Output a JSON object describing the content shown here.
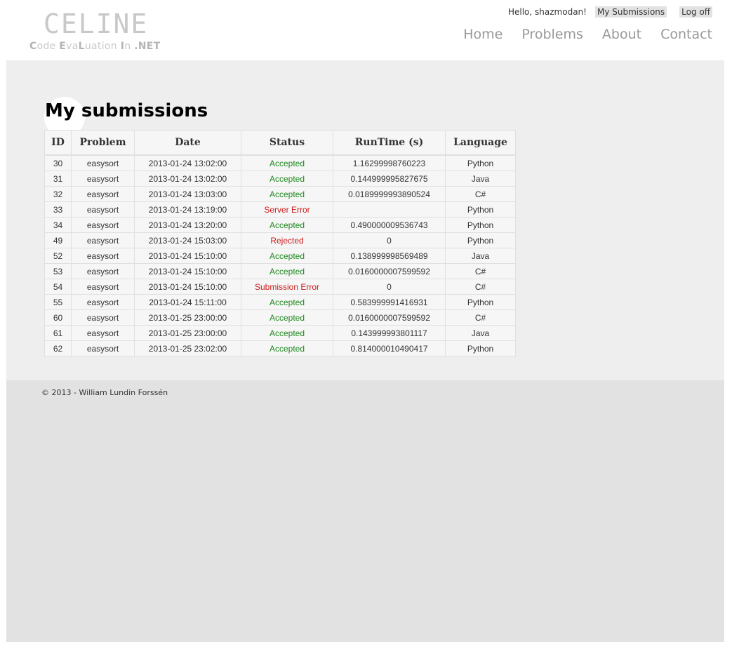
{
  "header": {
    "logo": "CELINE",
    "tagline_parts": [
      {
        "t": "C",
        "b": true
      },
      {
        "t": "ode ",
        "b": false
      },
      {
        "t": "E",
        "b": true
      },
      {
        "t": "va",
        "b": false
      },
      {
        "t": "L",
        "b": true
      },
      {
        "t": "uation ",
        "b": false
      },
      {
        "t": "I",
        "b": true
      },
      {
        "t": "n ",
        "b": false
      },
      {
        "t": ".NET",
        "b": true
      }
    ],
    "greeting": "Hello, shazmodan!",
    "my_submissions_link": "My Submissions",
    "logoff_link": "Log off",
    "nav": [
      "Home",
      "Problems",
      "About",
      "Contact"
    ]
  },
  "main": {
    "title": "My submissions",
    "table": {
      "columns": [
        "ID",
        "Problem",
        "Date",
        "Status",
        "RunTime (s)",
        "Language"
      ],
      "rows": [
        {
          "id": "30",
          "problem": "easysort",
          "date": "2013-01-24 13:02:00",
          "status": "Accepted",
          "runtime": "1.16299998760223",
          "language": "Python"
        },
        {
          "id": "31",
          "problem": "easysort",
          "date": "2013-01-24 13:02:00",
          "status": "Accepted",
          "runtime": "0.144999995827675",
          "language": "Java"
        },
        {
          "id": "32",
          "problem": "easysort",
          "date": "2013-01-24 13:03:00",
          "status": "Accepted",
          "runtime": "0.0189999993890524",
          "language": "C#"
        },
        {
          "id": "33",
          "problem": "easysort",
          "date": "2013-01-24 13:19:00",
          "status": "Server Error",
          "runtime": "",
          "language": "Python"
        },
        {
          "id": "34",
          "problem": "easysort",
          "date": "2013-01-24 13:20:00",
          "status": "Accepted",
          "runtime": "0.490000009536743",
          "language": "Python"
        },
        {
          "id": "49",
          "problem": "easysort",
          "date": "2013-01-24 15:03:00",
          "status": "Rejected",
          "runtime": "0",
          "language": "Python"
        },
        {
          "id": "52",
          "problem": "easysort",
          "date": "2013-01-24 15:10:00",
          "status": "Accepted",
          "runtime": "0.138999998569489",
          "language": "Java"
        },
        {
          "id": "53",
          "problem": "easysort",
          "date": "2013-01-24 15:10:00",
          "status": "Accepted",
          "runtime": "0.0160000007599592",
          "language": "C#"
        },
        {
          "id": "54",
          "problem": "easysort",
          "date": "2013-01-24 15:10:00",
          "status": "Submission Error",
          "runtime": "0",
          "language": "C#"
        },
        {
          "id": "55",
          "problem": "easysort",
          "date": "2013-01-24 15:11:00",
          "status": "Accepted",
          "runtime": "0.583999991416931",
          "language": "Python"
        },
        {
          "id": "60",
          "problem": "easysort",
          "date": "2013-01-25 23:00:00",
          "status": "Accepted",
          "runtime": "0.0160000007599592",
          "language": "C#"
        },
        {
          "id": "61",
          "problem": "easysort",
          "date": "2013-01-25 23:00:00",
          "status": "Accepted",
          "runtime": "0.143999993801117",
          "language": "Java"
        },
        {
          "id": "62",
          "problem": "easysort",
          "date": "2013-01-25 23:02:00",
          "status": "Accepted",
          "runtime": "0.814000010490417",
          "language": "Python"
        }
      ]
    }
  },
  "footer": {
    "text": "© 2013 - William Lundin Forssén"
  },
  "colors": {
    "status_ok": "#1f8a1f",
    "status_error": "#cc1a1a",
    "body_background": "#efeeef",
    "footer_background": "#e2e2e2"
  }
}
